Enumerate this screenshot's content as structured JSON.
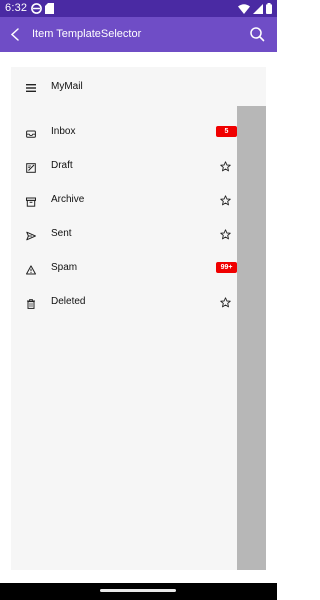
{
  "status_bar": {
    "time": "6:32"
  },
  "app_bar": {
    "title": "Item TemplateSelector"
  },
  "drawer": {
    "header_title": "MyMail",
    "items": [
      {
        "label": "Inbox",
        "badge": "5",
        "icon": "inbox-icon"
      },
      {
        "label": "Draft",
        "icon": "draft-icon"
      },
      {
        "label": "Archive",
        "icon": "archive-icon"
      },
      {
        "label": "Sent",
        "icon": "sent-icon"
      },
      {
        "label": "Spam",
        "badge": "99+",
        "icon": "warning-icon"
      },
      {
        "label": "Deleted",
        "icon": "trash-icon"
      }
    ]
  },
  "colors": {
    "status_bar": "#4a2aa3",
    "app_bar": "#6f4dc6",
    "badge": "#f00000",
    "drawer_bg": "#f6f6f6",
    "scroll_area": "#b7b7b7"
  }
}
